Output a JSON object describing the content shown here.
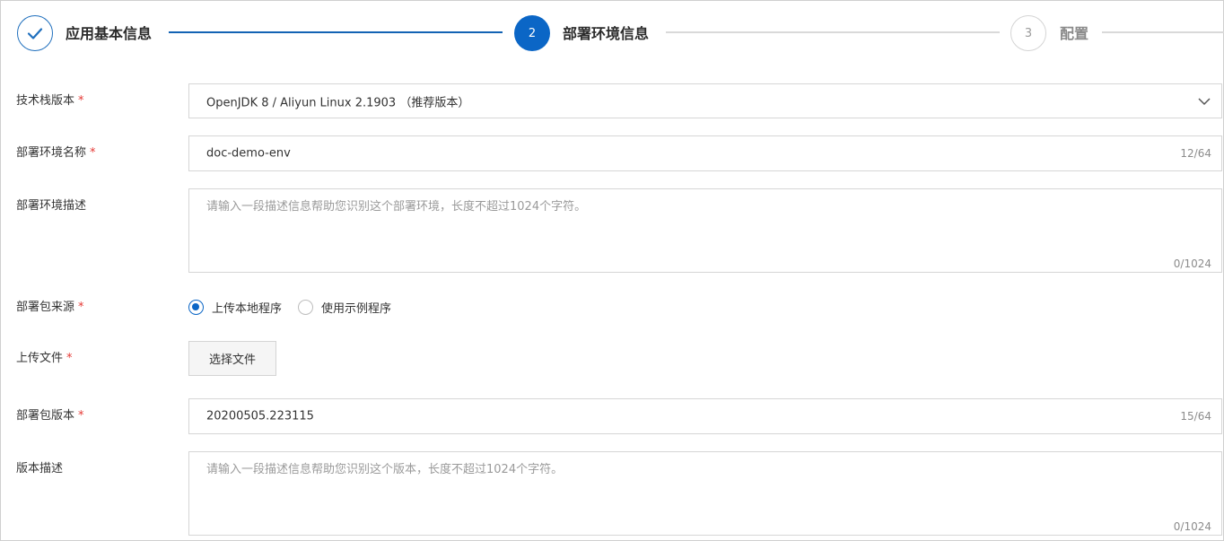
{
  "steps": [
    {
      "number": "✓",
      "title": "应用基本信息",
      "state": "done"
    },
    {
      "number": "2",
      "title": "部署环境信息",
      "state": "active"
    },
    {
      "number": "3",
      "title": "配置",
      "state": "pending"
    }
  ],
  "form": {
    "stack_version": {
      "label": "技术栈版本",
      "required": "*",
      "value": "OpenJDK 8 / Aliyun Linux 2.1903 （推荐版本）"
    },
    "env_name": {
      "label": "部署环境名称",
      "required": "*",
      "value": "doc-demo-env",
      "counter": "12/64"
    },
    "env_desc": {
      "label": "部署环境描述",
      "placeholder": "请输入一段描述信息帮助您识别这个部署环境，长度不超过1024个字符。",
      "counter": "0/1024"
    },
    "package_source": {
      "label": "部署包来源",
      "required": "*",
      "options": [
        {
          "label": "上传本地程序",
          "checked": true
        },
        {
          "label": "使用示例程序",
          "checked": false
        }
      ]
    },
    "upload_file": {
      "label": "上传文件",
      "required": "*",
      "button": "选择文件"
    },
    "package_version": {
      "label": "部署包版本",
      "required": "*",
      "value": "20200505.223115",
      "counter": "15/64"
    },
    "version_desc": {
      "label": "版本描述",
      "placeholder": "请输入一段描述信息帮助您识别这个版本，长度不超过1024个字符。",
      "counter": "0/1024"
    }
  },
  "colors": {
    "primary": "#0b66c6",
    "required": "#e53935",
    "border": "#d6d6d6"
  },
  "icons": {
    "check": "check-icon",
    "dropdown": "chevron-down-icon"
  }
}
